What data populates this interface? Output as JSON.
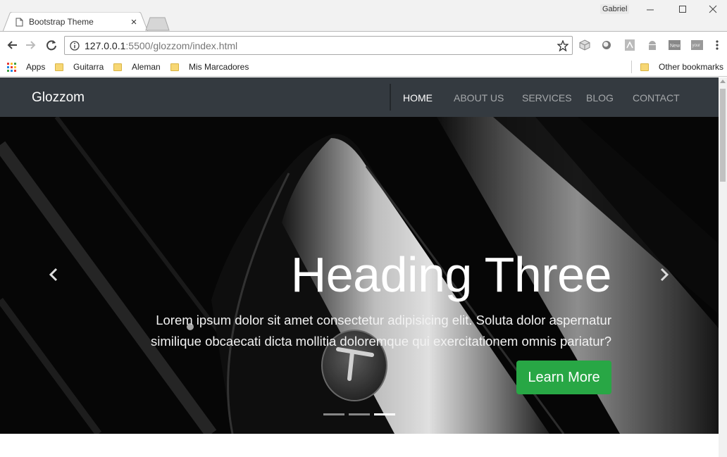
{
  "browser": {
    "tab_title": "Bootstrap Theme",
    "tab_close": "×",
    "profile_name": "Gabriel",
    "url_host": "127.0.0.1",
    "url_rest": ":5500/glozzom/index.html",
    "bookmarks": [
      {
        "label": "Apps",
        "kind": "apps"
      },
      {
        "label": "Guitarra",
        "kind": "folder"
      },
      {
        "label": "Aleman",
        "kind": "folder"
      },
      {
        "label": "Mis Marcadores",
        "kind": "folder"
      }
    ],
    "other_bookmarks": "Other bookmarks"
  },
  "site": {
    "brand": "Glozzom",
    "nav": [
      {
        "label": "HOME",
        "active": true
      },
      {
        "label": "ABOUT US",
        "active": false
      },
      {
        "label": "SERVICES",
        "active": false
      },
      {
        "label": "BLOG",
        "active": false
      },
      {
        "label": "CONTACT",
        "active": false
      }
    ]
  },
  "carousel": {
    "heading": "Heading Three",
    "text": "Lorem ipsum dolor sit amet consectetur adipisicing elit. Soluta dolor aspernatur similique obcaecati dicta mollitia doloremque qui exercitationem omnis pariatur?",
    "button_label": "Learn More",
    "slide_count": 3,
    "active_slide": 3
  },
  "colors": {
    "navbar": "#343a40",
    "success": "#28a745"
  }
}
